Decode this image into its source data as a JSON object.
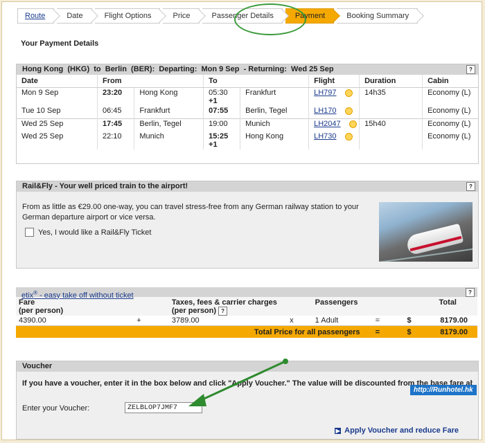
{
  "breadcrumbs": [
    {
      "label": "Route",
      "state": "link"
    },
    {
      "label": "Date",
      "state": "done"
    },
    {
      "label": "Flight Options",
      "state": "done"
    },
    {
      "label": "Price",
      "state": "done"
    },
    {
      "label": "Passenger Details",
      "state": "done"
    },
    {
      "label": "Payment",
      "state": "active"
    },
    {
      "label": "Booking Summary",
      "state": "todo"
    }
  ],
  "page_title": "Your Payment Details",
  "itinerary": {
    "title": "Hong Kong  (HKG)  to  Berlin  (BER):  Departing:  Mon 9 Sep  - Returning:  Wed 25 Sep",
    "help": "?",
    "headers": [
      "Date",
      "From",
      "",
      "To",
      "",
      "Flight",
      "Duration",
      "Cabin"
    ],
    "rows": [
      {
        "date": "Mon 9 Sep",
        "dep_time": "23:20",
        "dep_bold": true,
        "from": "Hong Kong",
        "arr_time": "05:30",
        "arr_extra": "+1",
        "arr_bold": false,
        "to": "Frankfurt",
        "flight": "LH797",
        "duration": "14h35",
        "cabin": "Economy  (L)"
      },
      {
        "date": "Tue 10 Sep",
        "dep_time": "06:45",
        "dep_bold": false,
        "from": "Frankfurt",
        "arr_time": "07:55",
        "arr_extra": "",
        "arr_bold": true,
        "to": "Berlin, Tegel",
        "flight": "LH170",
        "duration": "",
        "cabin": "Economy  (L)"
      },
      {
        "date": "Wed 25 Sep",
        "dep_time": "17:45",
        "dep_bold": true,
        "from": "Berlin, Tegel",
        "arr_time": "19:00",
        "arr_extra": "",
        "arr_bold": false,
        "to": "Munich",
        "flight": "LH2047",
        "duration": "15h40",
        "cabin": "Economy  (L)"
      },
      {
        "date": "Wed 25 Sep",
        "dep_time": "22:10",
        "dep_bold": false,
        "from": "Munich",
        "arr_time": "15:25",
        "arr_extra": "+1",
        "arr_bold": true,
        "to": "Hong Kong",
        "flight": "LH730",
        "duration": "",
        "cabin": "Economy  (L)"
      }
    ]
  },
  "railfly": {
    "title": "Rail&Fly - Your well priced train to the airport!",
    "help": "?",
    "text": "From as little as €29.00 one-way, you can travel stress-free from any German railway station to your German departure airport or vice versa.",
    "checkbox_label": "Yes, I would like a Rail&Fly Ticket"
  },
  "fare": {
    "etix_brand": "etix",
    "etix_mark": "®",
    "etix_text": " - easy take off without ticket",
    "help": "?",
    "h_fare": "Fare",
    "h_fare_sub": "(per person)",
    "h_tax": "Taxes, fees & carrier charges",
    "h_tax_sub": "(per person)",
    "h_pax": "Passengers",
    "h_total": "Total",
    "fare": "4390.00",
    "plus": "+",
    "tax": "3789.00",
    "times": "x",
    "pax": "1  Adult",
    "equals": "=",
    "currency": "$",
    "total": "8179.00",
    "total_label": "Total Price for all passengers",
    "grand_total": "8179.00"
  },
  "voucher": {
    "title": "Voucher",
    "instructions": "If you have a voucher, enter it in the box below and click \"Apply Voucher.\" The value will be discounted from the base fare above.",
    "label": "Enter your Voucher:",
    "value": "ZELBLOP7JMF7",
    "apply_label": "Apply Voucher and reduce Fare"
  },
  "watermark": "http://Runhotel.hk",
  "colors": {
    "accent": "#f5a800",
    "annotation": "#3a9a3a",
    "link": "#1a3a8c"
  }
}
